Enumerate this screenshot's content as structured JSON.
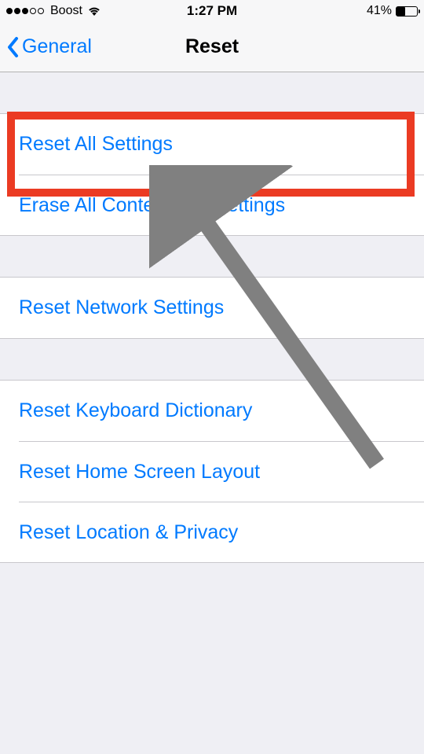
{
  "status_bar": {
    "carrier": "Boost",
    "time": "1:27 PM",
    "battery_pct": "41%",
    "battery_fill_pct": 41
  },
  "nav": {
    "back_label": "General",
    "title": "Reset"
  },
  "groups": [
    {
      "rows": [
        {
          "id": "reset-all-settings",
          "label": "Reset All Settings"
        },
        {
          "id": "erase-all",
          "label": "Erase All Content and Settings"
        }
      ]
    },
    {
      "rows": [
        {
          "id": "reset-network",
          "label": "Reset Network Settings"
        }
      ]
    },
    {
      "rows": [
        {
          "id": "reset-keyboard",
          "label": "Reset Keyboard Dictionary"
        },
        {
          "id": "reset-home",
          "label": "Reset Home Screen Layout"
        },
        {
          "id": "reset-location",
          "label": "Reset Location & Privacy"
        }
      ]
    }
  ],
  "annotations": {
    "highlight_row_id": "reset-all-settings",
    "highlight_color": "#eb3b23",
    "arrow_color": "#808080"
  }
}
